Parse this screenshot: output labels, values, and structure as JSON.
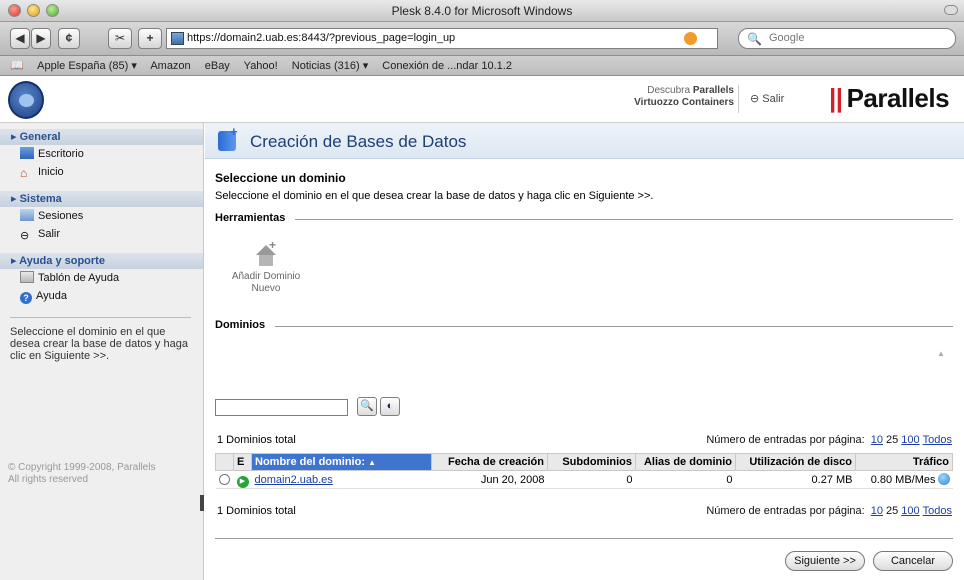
{
  "browser": {
    "title": "Plesk 8.4.0 for Microsoft Windows",
    "url": "https://domain2.uab.es:8443/?previous_page=login_up",
    "search_placeholder": "Google",
    "bookmarks": [
      "Apple España (85) ▾",
      "Amazon",
      "eBay",
      "Yahoo!",
      "Noticias (316) ▾",
      "Conexión de ...ndar 10.1.2"
    ]
  },
  "header": {
    "virt_line1": "Descubra",
    "virt_brand": "Parallels",
    "virt_line2": "Virtuozzo Containers",
    "salir": "Salir",
    "brand": "Parallels"
  },
  "sidebar": {
    "general": {
      "title": "General",
      "items": [
        "Escritorio",
        "Inicio"
      ]
    },
    "sistema": {
      "title": "Sistema",
      "items": [
        "Sesiones",
        "Salir"
      ]
    },
    "ayuda": {
      "title": "Ayuda y soporte",
      "items": [
        "Tablón de Ayuda",
        "Ayuda"
      ]
    },
    "help_text": "Seleccione el dominio en el que desea crear la base de datos y haga clic en Siguiente >>.",
    "copyright_1": "© Copyright 1999-2008, Parallels",
    "copyright_2": "All rights reserved"
  },
  "main": {
    "title": "Creación de Bases de Datos",
    "select_title": "Seleccione un dominio",
    "select_desc": "Seleccione el dominio en el que desea crear la base de datos y haga clic en Siguiente >>.",
    "tools_label": "Herramientas",
    "add_domain_1": "Añadir Dominio",
    "add_domain_2": "Nuevo",
    "domains_label": "Dominios",
    "total_text": "1 Dominios total",
    "per_page_label": "Número de entradas por página:",
    "per_page_options": [
      "10",
      "25",
      "100",
      "Todos"
    ],
    "columns": [
      "E",
      "Nombre del dominio:",
      "Fecha de creación",
      "Subdominios",
      "Alias de dominio",
      "Utilización de disco",
      "Tráfico"
    ],
    "rows": [
      {
        "name": "domain2.uab.es",
        "created": "Jun 20, 2008",
        "subdomains": "0",
        "aliases": "0",
        "disk": "0.27 MB",
        "traffic": "0.80 MB/Mes"
      }
    ],
    "next_button": "Siguiente >>",
    "cancel_button": "Cancelar"
  }
}
